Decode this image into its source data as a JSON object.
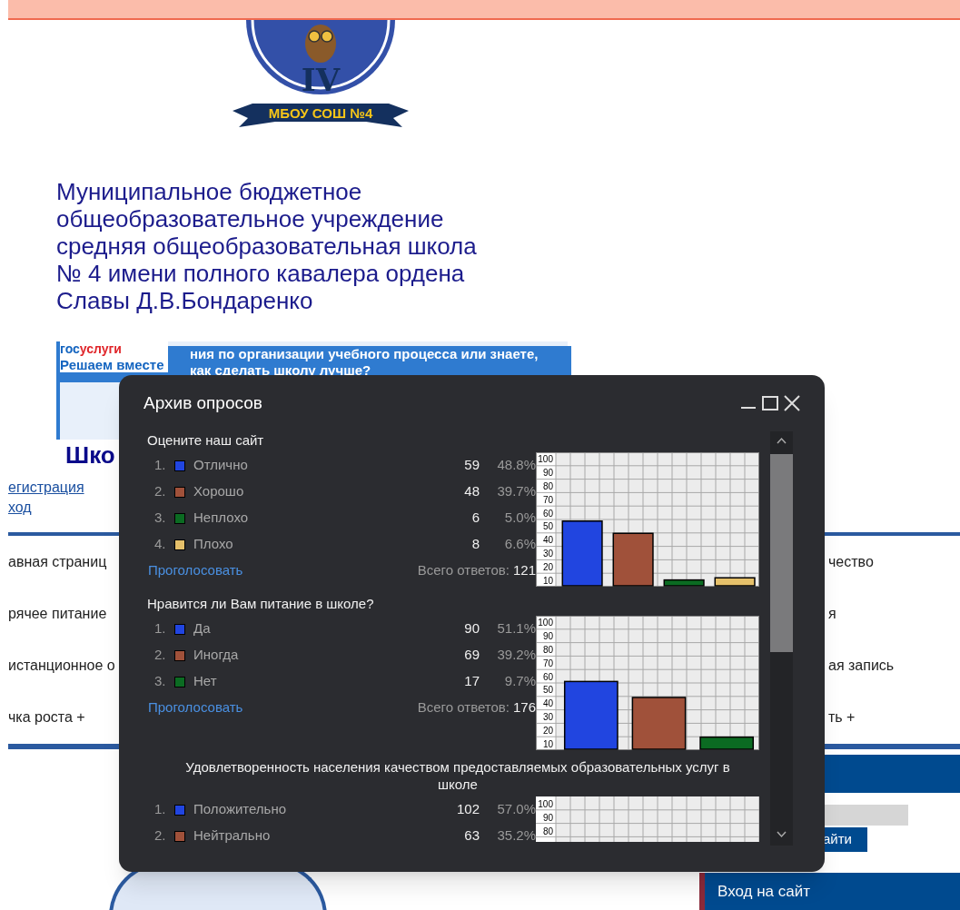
{
  "logo": {
    "numeral": "IV",
    "banner_text": "МБОУ СОШ №4"
  },
  "school_name_lines": [
    "Муниципальное бюджетное",
    "общеобразовательное учреждение",
    "средняя общеобразовательная школа",
    "№ 4 имени полного кавалера ордена",
    "Славы Д.В.Бондаренко"
  ],
  "banner": {
    "brand_parts": [
      "гос",
      "услуги"
    ],
    "slogan": "Решаем вместе",
    "text_lines": [
      "ния по организации учебного процесса или знаете,",
      "как сделать школу лучше?"
    ]
  },
  "heading_fragment": "Шко",
  "auth_links": [
    "егистрация",
    "ход"
  ],
  "nav_left": [
    "авная страниц",
    "рячее питание",
    "истанционное о",
    "чка роста +"
  ],
  "nav_right": [
    "чество",
    "я",
    "ая запись",
    "ть +"
  ],
  "search_button": "айти",
  "login_title": "Вход на сайт",
  "dialog": {
    "title": "Архив опросов",
    "polls": [
      {
        "question": "Оцените наш сайт",
        "centered": false,
        "options": [
          {
            "number": "1.",
            "label": "Отлично",
            "color": "#2145e0",
            "count": "59",
            "percent": "48.8%"
          },
          {
            "number": "2.",
            "label": "Хорошо",
            "color": "#a0513a",
            "count": "48",
            "percent": "39.7%"
          },
          {
            "number": "3.",
            "label": "Неплохо",
            "color": "#0b6b22",
            "count": "6",
            "percent": "5.0%"
          },
          {
            "number": "4.",
            "label": "Плохо",
            "color": "#e5c06a",
            "count": "8",
            "percent": "6.6%"
          }
        ],
        "vote_link": "Проголосовать",
        "total_label": "Всего ответов:",
        "total": "121",
        "chart_data": {
          "type": "bar",
          "grid": true,
          "values": [
            48.8,
            39.7,
            5.0,
            6.6
          ],
          "ylim": [
            0,
            100
          ],
          "yticks": [
            10,
            20,
            30,
            40,
            50,
            60,
            70,
            80,
            90,
            100
          ]
        }
      },
      {
        "question": "Нравится ли Вам питание в школе?",
        "centered": false,
        "options": [
          {
            "number": "1.",
            "label": "Да",
            "color": "#2145e0",
            "count": "90",
            "percent": "51.1%"
          },
          {
            "number": "2.",
            "label": "Иногда",
            "color": "#a0513a",
            "count": "69",
            "percent": "39.2%"
          },
          {
            "number": "3.",
            "label": "Нет",
            "color": "#0b6b22",
            "count": "17",
            "percent": "9.7%"
          }
        ],
        "vote_link": "Проголосовать",
        "total_label": "Всего ответов:",
        "total": "176",
        "chart_data": {
          "type": "bar",
          "grid": true,
          "values": [
            51.1,
            39.2,
            9.7
          ],
          "ylim": [
            0,
            100
          ],
          "yticks": [
            10,
            20,
            30,
            40,
            50,
            60,
            70,
            80,
            90,
            100
          ]
        }
      },
      {
        "question": "Удовлетворенность населения качеством предоставляемых образовательных услуг в школе",
        "centered": true,
        "options": [
          {
            "number": "1.",
            "label": "Положительно",
            "color": "#2145e0",
            "count": "102",
            "percent": "57.0%"
          },
          {
            "number": "2.",
            "label": "Нейтрально",
            "color": "#a0513a",
            "count": "63",
            "percent": "35.2%"
          }
        ],
        "grid_ticks": [
          "100",
          "90",
          "80"
        ]
      }
    ]
  }
}
